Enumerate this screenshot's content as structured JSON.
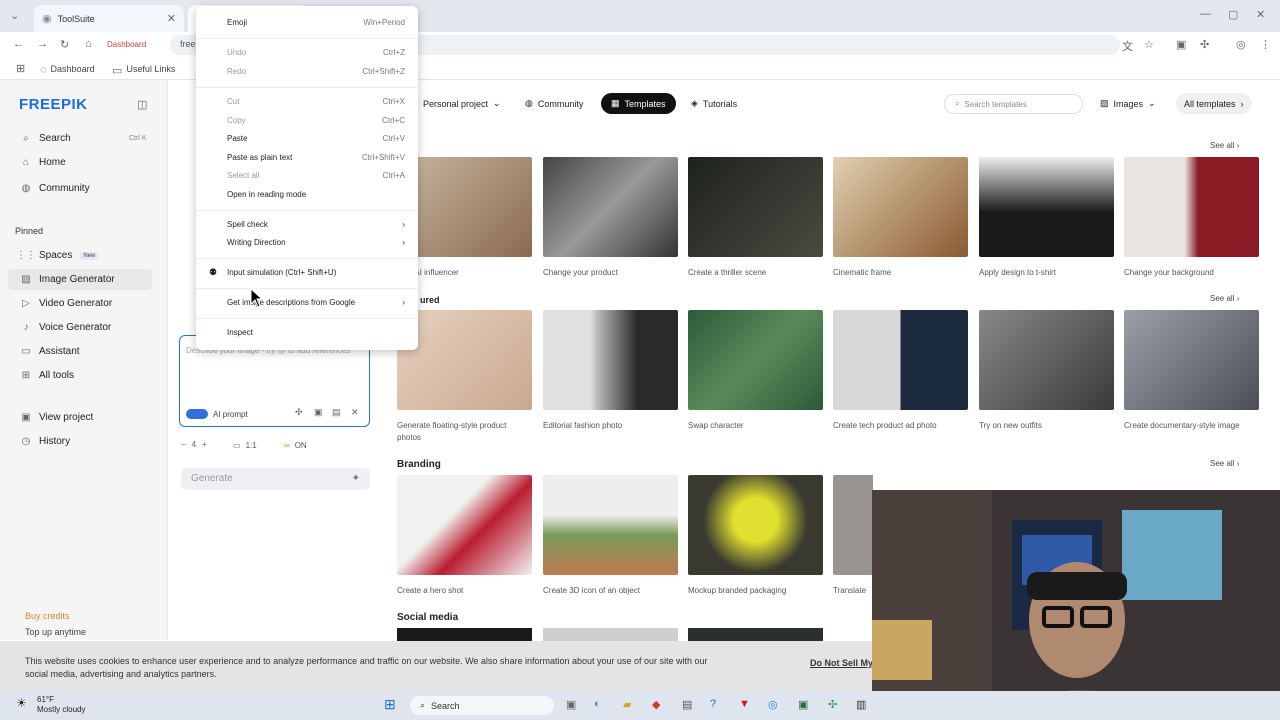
{
  "browser": {
    "tabs": [
      {
        "label": "ToolSuite"
      },
      {
        "label": ""
      }
    ],
    "address": "free",
    "home_label": "Dashboard",
    "bookmarks": [
      {
        "label": "Dashboard"
      },
      {
        "label": "Useful Links"
      }
    ]
  },
  "sidebar": {
    "logo": "FREEPIK",
    "search": "Search",
    "search_shortcut": "Ctrl K",
    "home": "Home",
    "community": "Community",
    "pinned": "Pinned",
    "items": [
      {
        "label": "Spaces",
        "badge": "New"
      },
      {
        "label": "Image Generator"
      },
      {
        "label": "Video Generator"
      },
      {
        "label": "Voice Generator"
      },
      {
        "label": "Assistant"
      },
      {
        "label": "All tools"
      }
    ],
    "view_project": "View project",
    "history": "History",
    "buy_credits": "Buy credits",
    "top_up": "Top up anytime"
  },
  "panel": {
    "prompt_placeholder": "Describe your image - try @ to add references",
    "ai_prompt": "AI prompt",
    "count": "4",
    "ratio": "1:1",
    "toggle": "ON",
    "generate": "Generate"
  },
  "topnav": {
    "personal": "Personal project",
    "community": "Community",
    "templates": "Templates",
    "tutorials": "Tutorials",
    "search_placeholder": "Search templates",
    "images": "Images",
    "all_templates": "All templates"
  },
  "sections": {
    "featured": "ured",
    "branding": "Branding",
    "social": "Social media",
    "see_all": "See all"
  },
  "row1": [
    {
      "label": "e an AI influencer",
      "color": "#b08060"
    },
    {
      "label": "Change your product",
      "color": "#6a6a6a"
    },
    {
      "label": "Create a thriller scene",
      "color": "#2a2d2a"
    },
    {
      "label": "Cinematic frame",
      "color": "#a88458"
    },
    {
      "label": "Apply design to t-shirt",
      "color": "#202020"
    },
    {
      "label": "Change your background",
      "color": "#8a1a24"
    }
  ],
  "row2": [
    {
      "label": "Generate floating-style product photos",
      "color": "#d9c2b0"
    },
    {
      "label": "Editorial fashion photo",
      "color": "#d8d8d8"
    },
    {
      "label": "Swap character",
      "color": "#3f6a48"
    },
    {
      "label": "Create tech product ad photo",
      "color": "#8b9098"
    },
    {
      "label": "Try on new outfits",
      "color": "#4a4a4a"
    },
    {
      "label": "Create documentary-style image",
      "color": "#777b80"
    }
  ],
  "row3": [
    {
      "label": "Create a hero shot",
      "color": "#e8e8e8"
    },
    {
      "label": "Create 3D icon of an object",
      "color": "#e4d8c8"
    },
    {
      "label": "Mockup branded packaging",
      "color": "#4a4a40"
    },
    {
      "label": "Translate",
      "color": "#9a9490"
    }
  ],
  "context_menu": [
    {
      "label": "Emoji",
      "shortcut": "Win+Period",
      "disabled": false
    },
    {
      "label": "Undo",
      "shortcut": "Ctrl+Z",
      "disabled": true
    },
    {
      "label": "Redo",
      "shortcut": "Ctrl+Shift+Z",
      "disabled": true
    },
    {
      "label": "Cut",
      "shortcut": "Ctrl+X",
      "disabled": true
    },
    {
      "label": "Copy",
      "shortcut": "Ctrl+C",
      "disabled": true
    },
    {
      "label": "Paste",
      "shortcut": "Ctrl+V",
      "disabled": false
    },
    {
      "label": "Paste as plain text",
      "shortcut": "Ctrl+Shift+V",
      "disabled": false
    },
    {
      "label": "Select all",
      "shortcut": "Ctrl+A",
      "disabled": true
    },
    {
      "label": "Open in reading mode",
      "shortcut": "",
      "disabled": false
    },
    {
      "label": "Spell check",
      "shortcut": "",
      "disabled": false
    },
    {
      "label": "Writing Direction",
      "shortcut": "",
      "disabled": false
    },
    {
      "label": "Input simulation (Ctrl+ Shift+U)",
      "shortcut": "",
      "disabled": false
    },
    {
      "label": "Get image descriptions from Google",
      "shortcut": "",
      "disabled": false
    },
    {
      "label": "Inspect",
      "shortcut": "",
      "disabled": false
    }
  ],
  "cookie": {
    "text": "This website uses cookies to enhance user experience and to analyze performance and traffic on our website. We also share information about your use of our site with our social media, advertising and analytics partners.",
    "do_not_sell": "Do Not Sell My"
  },
  "taskbar": {
    "temp": "61°F",
    "weather": "Mostly cloudy",
    "search": "Search"
  },
  "colors": {
    "accent": "#1c6be3",
    "templates_pill": "#111111",
    "buy_credits": "#d08a1e"
  }
}
